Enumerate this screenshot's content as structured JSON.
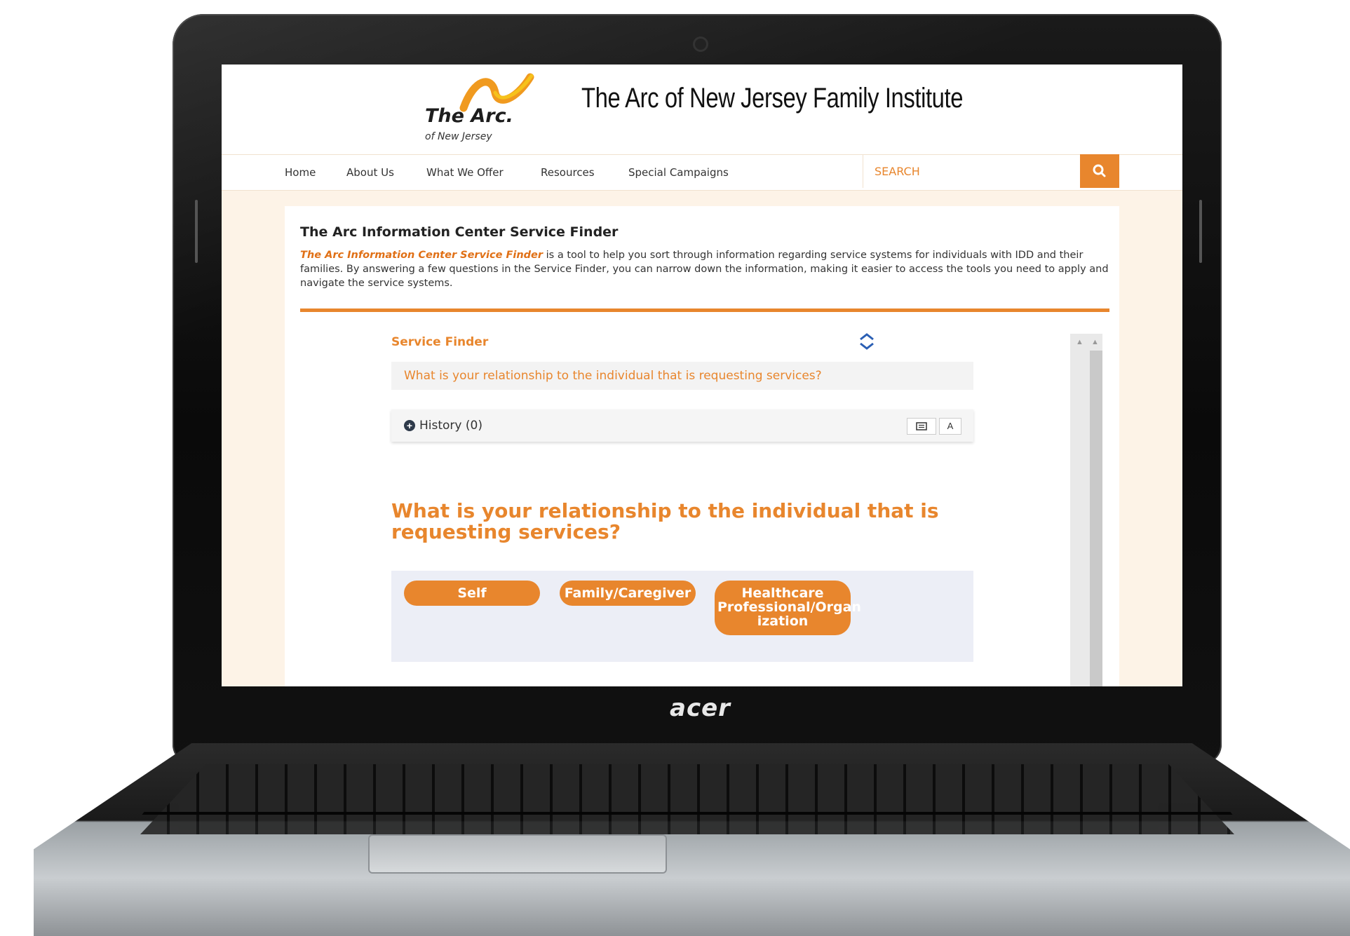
{
  "device": {
    "brand": "acer"
  },
  "site": {
    "logo_text": "The Arc.",
    "logo_sub": "of New Jersey",
    "title": "The Arc of New Jersey Family Institute"
  },
  "nav": {
    "items": [
      {
        "label": "Home"
      },
      {
        "label": "About Us"
      },
      {
        "label": "What We Offer"
      },
      {
        "label": "Resources"
      },
      {
        "label": "Special Campaigns"
      }
    ],
    "search_placeholder": "SEARCH",
    "search_icon": "search-icon"
  },
  "content": {
    "title": "The Arc Information Center Service Finder",
    "desc_link": "The Arc Information Center Service Finder",
    "desc_rest": " is a tool to help you sort through information regarding service systems for individuals with IDD and their families. By answering a few questions in the Service Finder, you can narrow down the information, making it easier to access the tools you need to apply and navigate the service systems."
  },
  "service_finder": {
    "heading": "Service Finder",
    "question_bar": "What is your relationship to the individual that is requesting services?",
    "history_label": "History (0)",
    "text_size_button": "A",
    "question": "What is your relationship to the individual that is requesting services?",
    "options": [
      {
        "label": "Self"
      },
      {
        "label": "Family/Caregiver"
      },
      {
        "label": "Healthcare Professional/Organ ization"
      }
    ]
  },
  "colors": {
    "accent": "#e8862d",
    "swap": "#2b5fb4"
  }
}
